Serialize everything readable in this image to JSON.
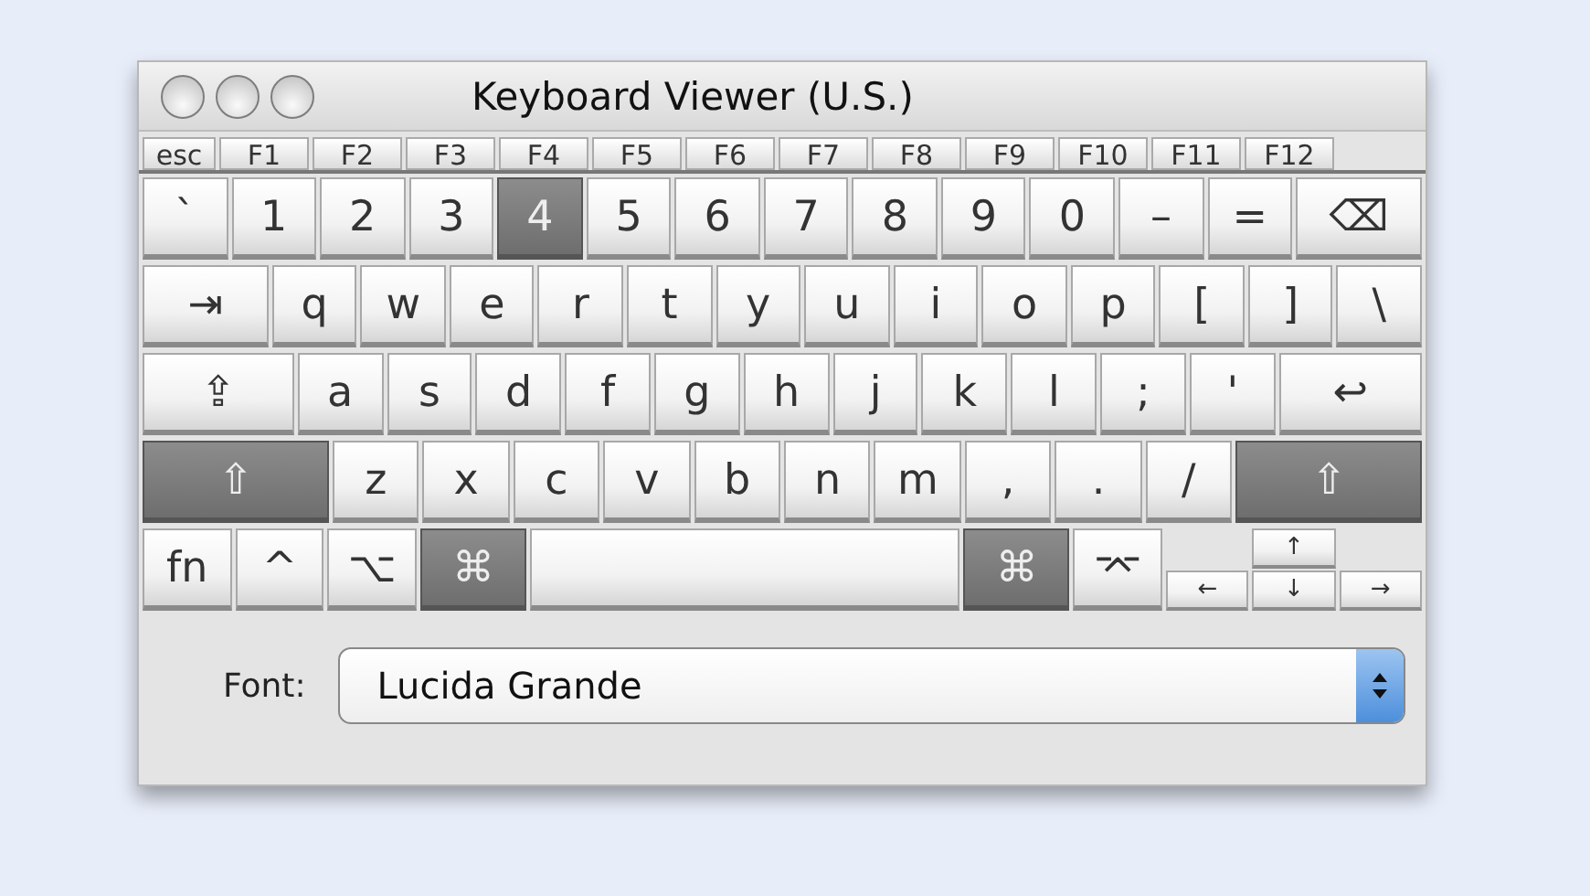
{
  "window": {
    "title": "Keyboard Viewer (U.S.)"
  },
  "function_keys": [
    {
      "label": "esc"
    },
    {
      "label": "F1"
    },
    {
      "label": "F2"
    },
    {
      "label": "F3"
    },
    {
      "label": "F4"
    },
    {
      "label": "F5"
    },
    {
      "label": "F6"
    },
    {
      "label": "F7"
    },
    {
      "label": "F8"
    },
    {
      "label": "F9"
    },
    {
      "label": "F10"
    },
    {
      "label": "F11"
    },
    {
      "label": "F12"
    }
  ],
  "rows": [
    [
      {
        "label": "`",
        "kind": "char",
        "pressed": false
      },
      {
        "label": "1",
        "kind": "char",
        "pressed": false
      },
      {
        "label": "2",
        "kind": "char",
        "pressed": false
      },
      {
        "label": "3",
        "kind": "char",
        "pressed": false
      },
      {
        "label": "4",
        "kind": "char",
        "pressed": true
      },
      {
        "label": "5",
        "kind": "char",
        "pressed": false
      },
      {
        "label": "6",
        "kind": "char",
        "pressed": false
      },
      {
        "label": "7",
        "kind": "char",
        "pressed": false
      },
      {
        "label": "8",
        "kind": "char",
        "pressed": false
      },
      {
        "label": "9",
        "kind": "char",
        "pressed": false
      },
      {
        "label": "0",
        "kind": "char",
        "pressed": false
      },
      {
        "label": "–",
        "kind": "char",
        "pressed": false
      },
      {
        "label": "=",
        "kind": "char",
        "pressed": false
      },
      {
        "label": "⌫",
        "kind": "delete",
        "pressed": false
      }
    ],
    [
      {
        "label": "⇥",
        "kind": "tab",
        "pressed": false
      },
      {
        "label": "q",
        "kind": "char",
        "pressed": false
      },
      {
        "label": "w",
        "kind": "char",
        "pressed": false
      },
      {
        "label": "e",
        "kind": "char",
        "pressed": false
      },
      {
        "label": "r",
        "kind": "char",
        "pressed": false
      },
      {
        "label": "t",
        "kind": "char",
        "pressed": false
      },
      {
        "label": "y",
        "kind": "char",
        "pressed": false
      },
      {
        "label": "u",
        "kind": "char",
        "pressed": false
      },
      {
        "label": "i",
        "kind": "char",
        "pressed": false
      },
      {
        "label": "o",
        "kind": "char",
        "pressed": false
      },
      {
        "label": "p",
        "kind": "char",
        "pressed": false
      },
      {
        "label": "[",
        "kind": "char",
        "pressed": false
      },
      {
        "label": "]",
        "kind": "char",
        "pressed": false
      },
      {
        "label": "\\",
        "kind": "char",
        "pressed": false
      }
    ],
    [
      {
        "label": "⇪",
        "kind": "caps",
        "pressed": false
      },
      {
        "label": "a",
        "kind": "char",
        "pressed": false
      },
      {
        "label": "s",
        "kind": "char",
        "pressed": false
      },
      {
        "label": "d",
        "kind": "char",
        "pressed": false
      },
      {
        "label": "f",
        "kind": "char",
        "pressed": false
      },
      {
        "label": "g",
        "kind": "char",
        "pressed": false
      },
      {
        "label": "h",
        "kind": "char",
        "pressed": false
      },
      {
        "label": "j",
        "kind": "char",
        "pressed": false
      },
      {
        "label": "k",
        "kind": "char",
        "pressed": false
      },
      {
        "label": "l",
        "kind": "char",
        "pressed": false
      },
      {
        "label": ";",
        "kind": "char",
        "pressed": false
      },
      {
        "label": "'",
        "kind": "char",
        "pressed": false
      },
      {
        "label": "↩",
        "kind": "return",
        "pressed": false
      }
    ],
    [
      {
        "label": "⇧",
        "kind": "shift",
        "pressed": true
      },
      {
        "label": "z",
        "kind": "char",
        "pressed": false
      },
      {
        "label": "x",
        "kind": "char",
        "pressed": false
      },
      {
        "label": "c",
        "kind": "char",
        "pressed": false
      },
      {
        "label": "v",
        "kind": "char",
        "pressed": false
      },
      {
        "label": "b",
        "kind": "char",
        "pressed": false
      },
      {
        "label": "n",
        "kind": "char",
        "pressed": false
      },
      {
        "label": "m",
        "kind": "char",
        "pressed": false
      },
      {
        "label": ",",
        "kind": "char",
        "pressed": false
      },
      {
        "label": ".",
        "kind": "char",
        "pressed": false
      },
      {
        "label": "/",
        "kind": "char",
        "pressed": false
      },
      {
        "label": "⇧",
        "kind": "shift",
        "pressed": true
      }
    ],
    [
      {
        "label": "fn",
        "kind": "char",
        "pressed": false
      },
      {
        "label": "^",
        "kind": "char",
        "pressed": false
      },
      {
        "label": "⌥",
        "kind": "char",
        "pressed": false
      },
      {
        "label": "⌘",
        "kind": "command",
        "pressed": true
      },
      {
        "kind": "space",
        "pressed": false
      },
      {
        "label": "⌘",
        "kind": "command",
        "pressed": true
      },
      {
        "label": "⌤",
        "kind": "char",
        "pressed": false
      },
      {
        "kind": "arrows"
      }
    ]
  ],
  "arrow_keys": [
    {
      "label": "↑",
      "pressed": false
    },
    {
      "label": "←",
      "pressed": false
    },
    {
      "label": "↓",
      "pressed": false
    },
    {
      "label": "→",
      "pressed": false
    }
  ],
  "font_popup": {
    "label": "Font:",
    "value": "Lucida Grande"
  }
}
